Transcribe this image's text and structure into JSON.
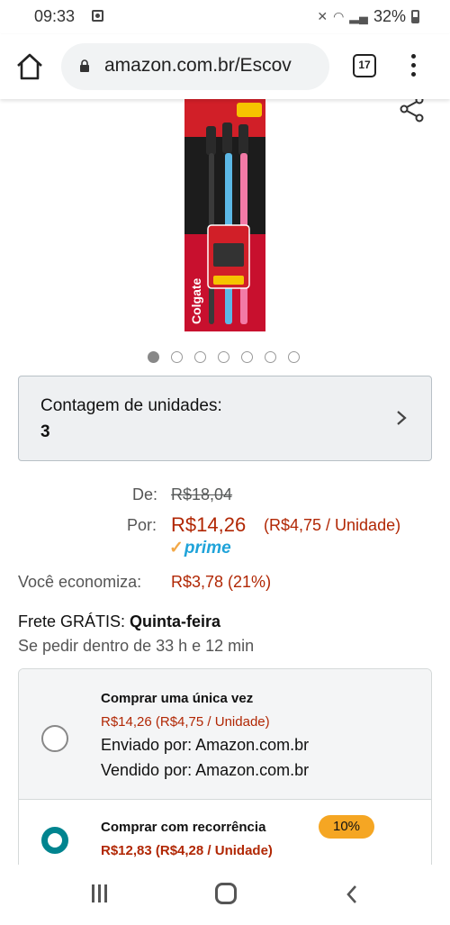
{
  "status_bar": {
    "time": "09:33",
    "battery": "32%"
  },
  "browser": {
    "url": "amazon.com.br/Escov",
    "tab_count": "17"
  },
  "product": {
    "image_alt": "Colgate Slim Soft Black 3 Pack",
    "carousel_total": 7,
    "carousel_active": 1
  },
  "unit_count": {
    "label": "Contagem de unidades:",
    "value": "3"
  },
  "pricing": {
    "list_label": "De:",
    "list_price": "R$18,04",
    "sale_label": "Por:",
    "sale_price": "R$14,26",
    "unit_price": "(R$4,75 / Unidade)",
    "prime": "prime",
    "savings_label": "Você economiza:",
    "savings_value": "R$3,78 (21%)"
  },
  "shipping": {
    "prefix": "Frete GRÁTIS:",
    "day": "Quinta-feira",
    "deadline": "Se pedir dentro de 33 h e 12 min"
  },
  "purchase_options": [
    {
      "title": "Comprar uma única vez",
      "price": "R$14,26 (R$4,75 / Unidade)",
      "shipped_by": "Enviado por: Amazon.com.br",
      "sold_by": "Vendido por: Amazon.com.br",
      "selected": false
    },
    {
      "title": "Comprar com recorrência",
      "badge": "10%",
      "price": "R$12,83 (R$4,28 / Unidade)",
      "selected": true
    }
  ],
  "colors": {
    "price_red": "#b12704",
    "prime_blue": "#1fa3d9",
    "radio_teal": "#00848f",
    "badge_orange": "#f5a623"
  }
}
